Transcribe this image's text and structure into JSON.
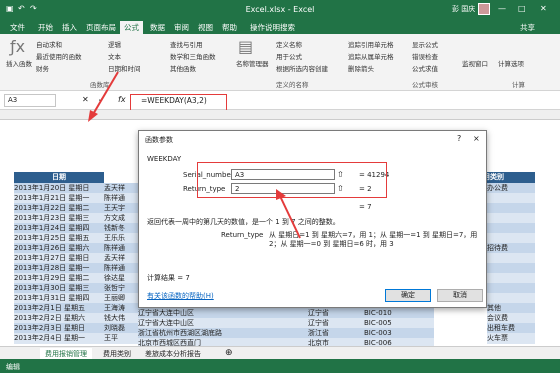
{
  "title": "Excel.xlsx - Excel",
  "user": "彭 国庆",
  "tabs": [
    "文件",
    "开始",
    "插入",
    "页面布局",
    "公式",
    "数据",
    "审阅",
    "视图",
    "帮助",
    "操作说明搜索"
  ],
  "share": "共享",
  "ribbon": {
    "insert_function": "插入函数",
    "autosum": "自动求和",
    "recent": "最近使用的函数",
    "financial": "财务",
    "logical": "逻辑",
    "text": "文本",
    "datetime": "日期和时间",
    "lookup": "查找与引用",
    "math": "数学和三角函数",
    "more": "其他函数",
    "name_manager": "名称管理器",
    "define_name": "定义名称",
    "use_in_formula": "用于公式",
    "create_from_sel": "根据所选内容创建",
    "trace_prec": "追踪引用单元格",
    "trace_dep": "追踪从属单元格",
    "remove_arrows": "删除箭头",
    "show_formulas": "显示公式",
    "error_check": "错误检查",
    "eval_formula": "公式求值",
    "watch": "监视窗口",
    "calc_options": "计算选项",
    "group_lib": "函数库",
    "group_names": "定义的名称",
    "group_audit": "公式审核",
    "group_calc": "计算"
  },
  "namebox": "A3",
  "fx": "fx",
  "formula": "=WEEKDAY(A3,2)",
  "sheet": {
    "headers": [
      "日期",
      "费用类别"
    ],
    "dates": [
      "2013年1月20日 星期日",
      "2013年1月21日 星期一",
      "2013年1月22日 星期二",
      "2013年1月23日 星期三",
      "2013年1月24日 星期四",
      "2013年1月25日 星期五",
      "2013年1月26日 星期六",
      "2013年1月27日 星期日",
      "2013年1月28日 星期一",
      "2013年1月29日 星期二",
      "2013年1月30日 星期三",
      "2013年1月31日 星期四",
      "2013年2月1日 星期五",
      "2013年2月2日 星期六",
      "2013年2月3日 星期日",
      "2013年2月4日 星期一",
      "2013年2月5日 星期二"
    ],
    "names": [
      "孟天祥",
      "陈祥通",
      "王天宇",
      "方文成",
      "钱新冬",
      "王乐乐",
      "陈祥通",
      "孟天祥",
      "陈祥通",
      "徐达星",
      "张哲宁",
      "王丽卿",
      "王海涛",
      "钱大伟",
      "刘晓磊",
      "王平",
      "关天胜"
    ],
    "rows_visible": [
      {
        "addr": "辽宁省大连中山区",
        "prov": "辽宁省",
        "code": "BIC-010",
        "cat": "其他"
      },
      {
        "addr": "辽宁省大连中山区",
        "prov": "辽宁省",
        "code": "BIC-005",
        "cat": "会议费"
      },
      {
        "addr": "浙江省杭州市西湖区湖底路",
        "prov": "浙江省",
        "code": "BIC-003",
        "cat": "出租车费"
      },
      {
        "addr": "北京市西城区西直门",
        "prov": "北京市",
        "code": "BIC-006",
        "cat": "火车票"
      }
    ],
    "cats_right": [
      "办公费",
      "",
      "",
      "",
      "",
      "",
      "招待费",
      "",
      "",
      "",
      "",
      "",
      "其他",
      "会议费",
      "出租车费",
      "火车票"
    ],
    "addr_rows": [
      "辽宁省大连中山区黄海大厦门前路(店)",
      "北京市东城区朝阳区",
      "浙江省杭州市西湖区湖底路",
      "北京市西城区西直门",
      "山东省青岛市市北区五四广场大门口楼"
    ]
  },
  "dialog": {
    "title": "函数参数",
    "help_q": "?",
    "close": "×",
    "fn": "WEEKDAY",
    "arg1_label": "Serial_number",
    "arg1_value": "A3",
    "arg1_result": "= 41294",
    "arg2_label": "Return_type",
    "arg2_value": "2",
    "arg2_result": "= 2",
    "result_line": "= 7",
    "desc": "返回代表一周中的第几天的数值，是一个 1 到 7 之间的整数。",
    "arg_help_label": "Return_type",
    "arg_help": "从 星期日=1 到 星期六=7，用 1；从 星期一=1 到 星期日=7，用 2；从 星期一=0 到 星期日=6 时，用 3",
    "calc_result": "计算结果 =  7",
    "help_link": "有关该函数的帮助(H)",
    "ok": "确定",
    "cancel": "取消"
  },
  "sheettabs": [
    "费用报销管理",
    "费用类别",
    "差旅成本分析报告"
  ],
  "status": "编辑"
}
